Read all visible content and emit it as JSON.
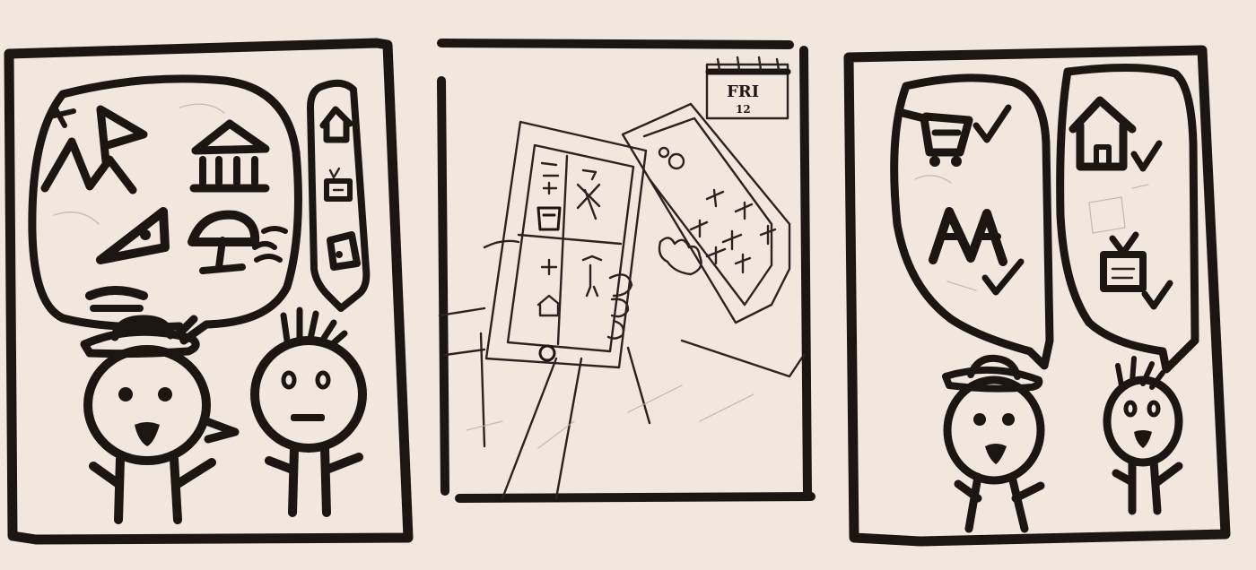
{
  "calendar": {
    "day": "FRI",
    "date": "12"
  },
  "colors": {
    "paper": "#f1e7dc",
    "ink": "#1c1613"
  }
}
